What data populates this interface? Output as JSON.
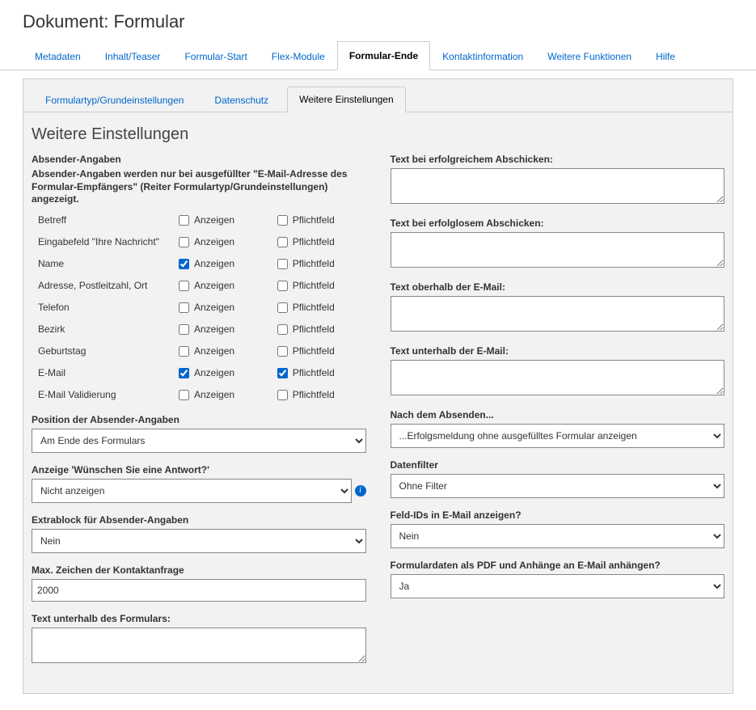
{
  "pageTitle": "Dokument: Formular",
  "mainTabs": [
    {
      "label": "Metadaten",
      "active": false
    },
    {
      "label": "Inhalt/Teaser",
      "active": false
    },
    {
      "label": "Formular-Start",
      "active": false
    },
    {
      "label": "Flex-Module",
      "active": false
    },
    {
      "label": "Formular-Ende",
      "active": true
    },
    {
      "label": "Kontaktinformation",
      "active": false
    },
    {
      "label": "Weitere Funktionen",
      "active": false
    },
    {
      "label": "Hilfe",
      "active": false
    }
  ],
  "subTabs": [
    {
      "label": "Formulartyp/Grundeinstellungen",
      "active": false
    },
    {
      "label": "Datenschutz",
      "active": false
    },
    {
      "label": "Weitere Einstellungen",
      "active": true
    }
  ],
  "sectionHeading": "Weitere Einstellungen",
  "senderHead": "Absender-Angaben",
  "senderDesc": "Absender-Angaben werden nur bei ausgefüllter \"E-Mail-Adresse des Formular-Empfängers\" (Reiter Formulartyp/Grundeinstellungen) angezeigt.",
  "colShow": "Anzeigen",
  "colReq": "Pflichtfeld",
  "senderRows": [
    {
      "label": "Betreff",
      "show": false,
      "req": false
    },
    {
      "label": "Eingabefeld \"Ihre Nachricht\"",
      "show": false,
      "req": false
    },
    {
      "label": "Name",
      "show": true,
      "req": false
    },
    {
      "label": "Adresse, Postleitzahl, Ort",
      "show": false,
      "req": false
    },
    {
      "label": "Telefon",
      "show": false,
      "req": false
    },
    {
      "label": "Bezirk",
      "show": false,
      "req": false
    },
    {
      "label": "Geburtstag",
      "show": false,
      "req": false
    },
    {
      "label": "E-Mail",
      "show": true,
      "req": true
    },
    {
      "label": "E-Mail Validierung",
      "show": false,
      "req": false
    }
  ],
  "left": {
    "position": {
      "label": "Position der Absender-Angaben",
      "value": "Am Ende des Formulars"
    },
    "answerDisplay": {
      "label": "Anzeige 'Wünschen Sie eine Antwort?'",
      "value": "Nicht anzeigen"
    },
    "extrablock": {
      "label": "Extrablock für Absender-Angaben",
      "value": "Nein"
    },
    "maxChars": {
      "label": "Max. Zeichen der Kontaktanfrage",
      "value": "2000"
    },
    "textBelowForm": {
      "label": "Text unterhalb des Formulars:",
      "value": ""
    }
  },
  "right": {
    "textSuccess": {
      "label": "Text bei erfolgreichem Abschicken:",
      "value": ""
    },
    "textFail": {
      "label": "Text bei erfolglosem Abschicken:",
      "value": ""
    },
    "textAboveMail": {
      "label": "Text oberhalb der E-Mail:",
      "value": ""
    },
    "textBelowMail": {
      "label": "Text unterhalb der E-Mail:",
      "value": ""
    },
    "afterSend": {
      "label": "Nach dem Absenden...",
      "value": "...Erfolgsmeldung ohne ausgefülltes Formular anzeigen"
    },
    "datenfilter": {
      "label": "Datenfilter",
      "value": "Ohne Filter"
    },
    "fieldIds": {
      "label": "Feld-IDs in E-Mail anzeigen?",
      "value": "Nein"
    },
    "pdfAttach": {
      "label": "Formulardaten als PDF und Anhänge an E-Mail anhängen?",
      "value": "Ja"
    }
  }
}
